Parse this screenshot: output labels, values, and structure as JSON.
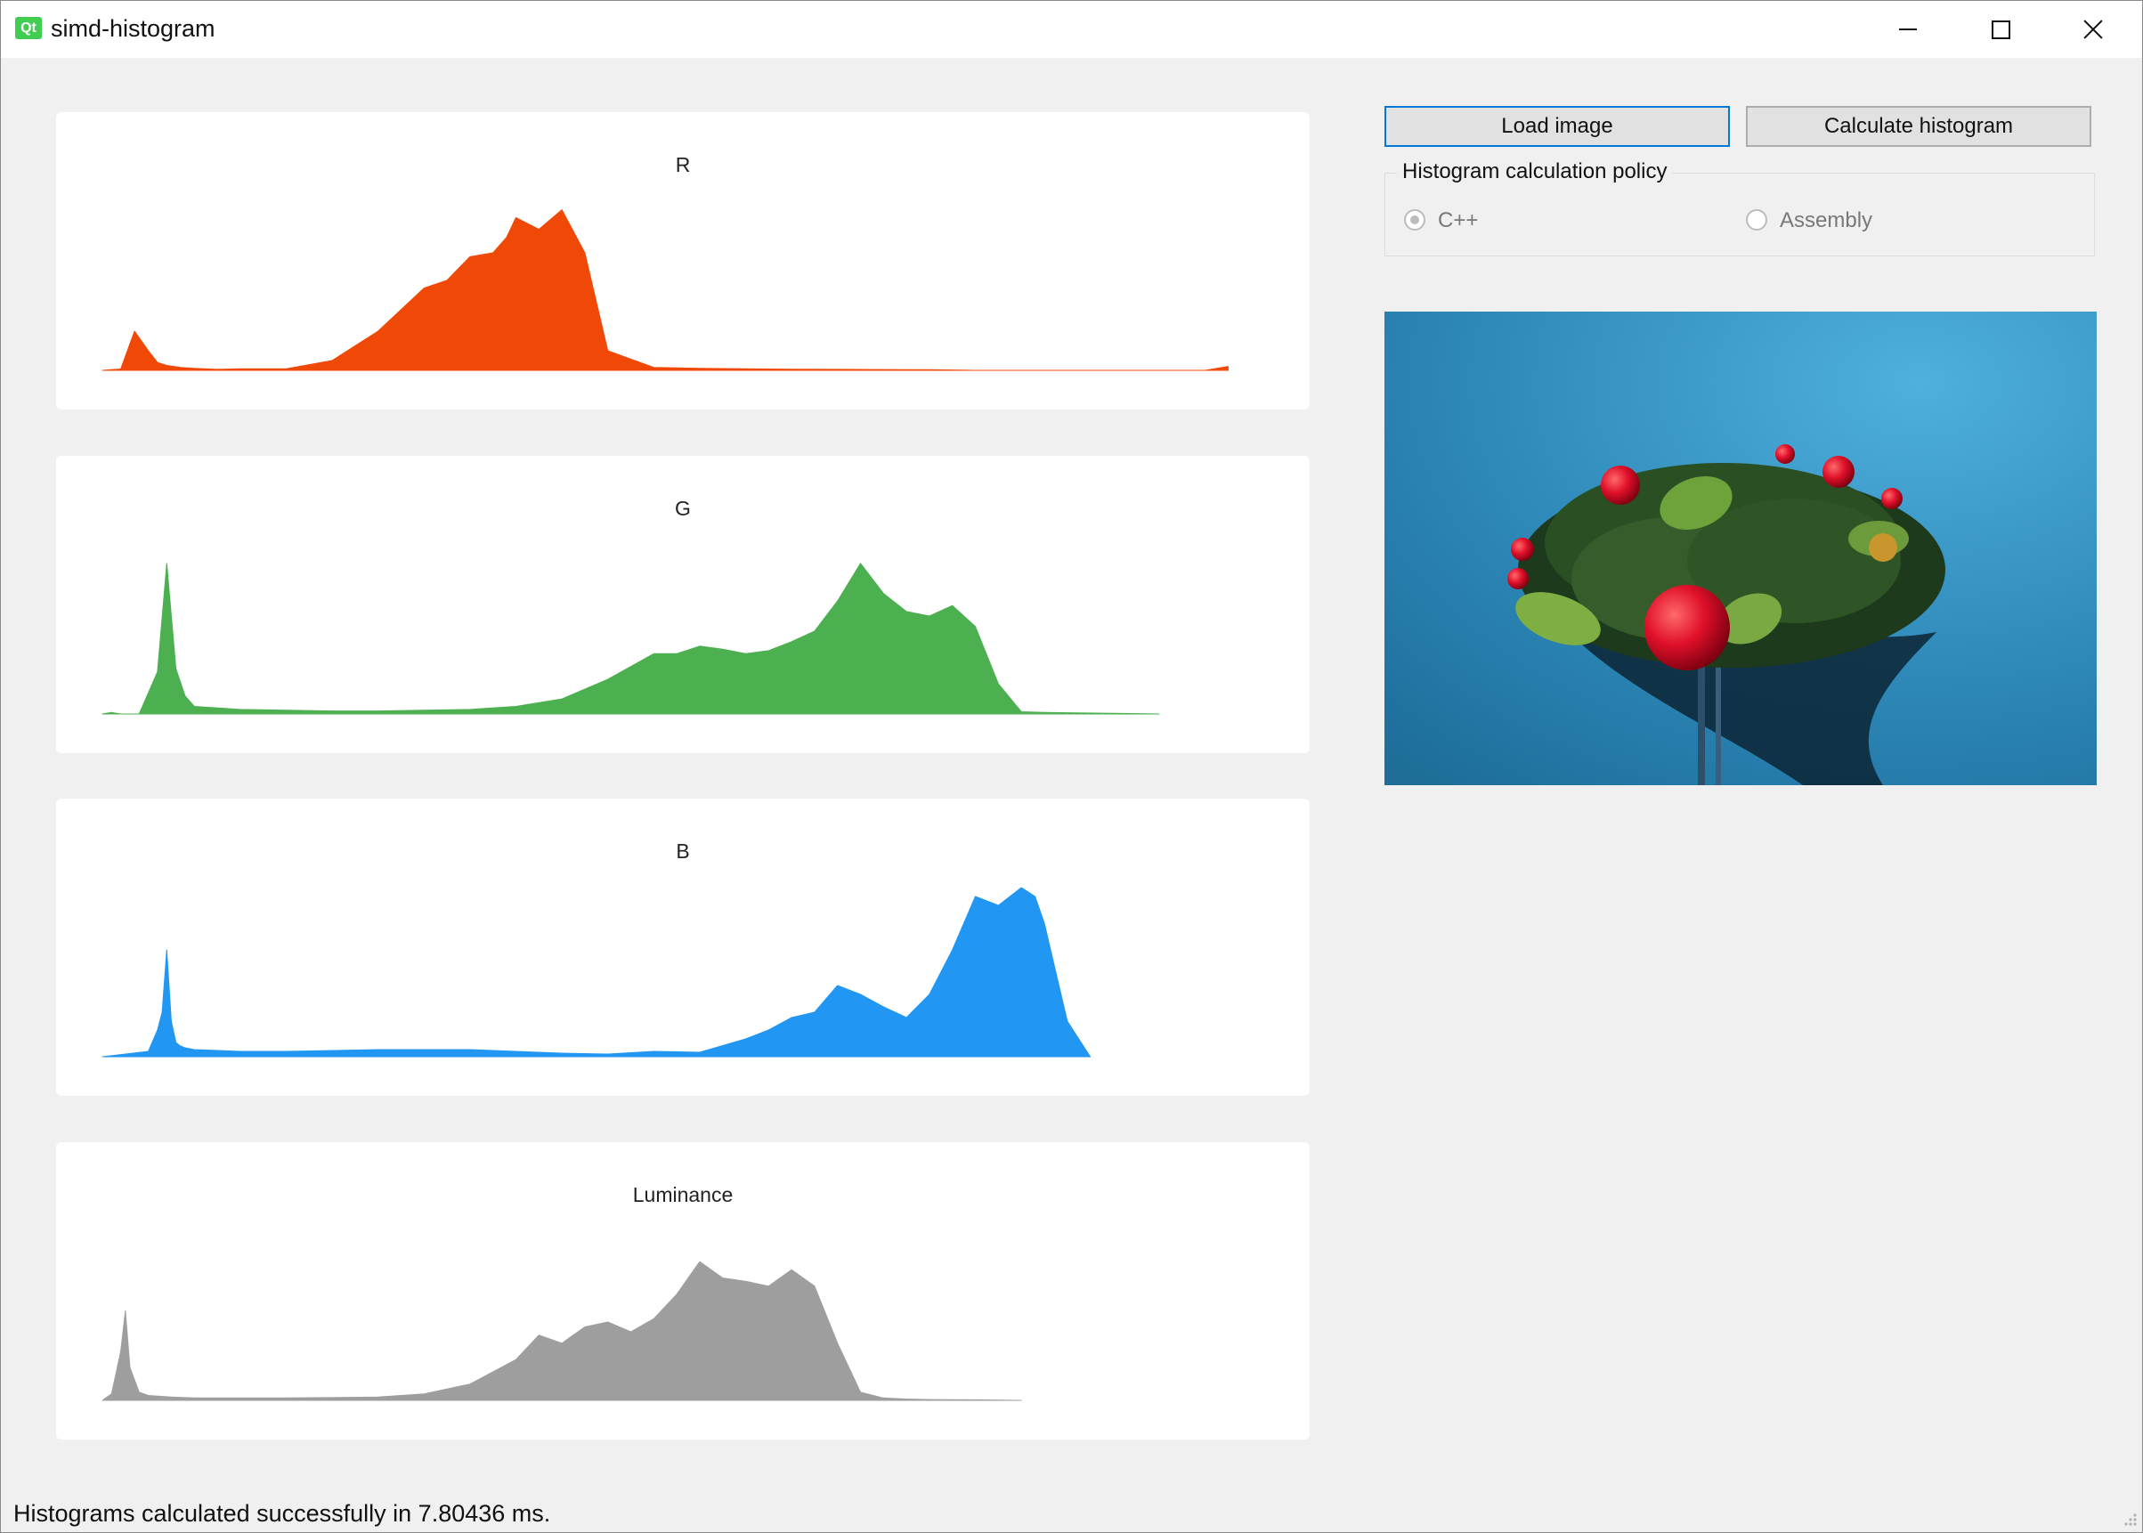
{
  "window": {
    "title": "simd-histogram",
    "logo_text": "Qt",
    "controls": [
      "minimize",
      "maximize",
      "close"
    ]
  },
  "toolbar": {
    "load_label": "Load image",
    "calculate_label": "Calculate histogram"
  },
  "policy": {
    "title": "Histogram calculation policy",
    "options": [
      {
        "label": "C++",
        "checked": true
      },
      {
        "label": "Assembly",
        "checked": false
      }
    ]
  },
  "status_text": "Histograms calculated successfully in 7.80436 ms.",
  "colors": {
    "red": "#f04907",
    "green": "#4caf50",
    "blue": "#2196f3",
    "luminance": "#9e9e9e",
    "photo_background": "#2f8cbc"
  },
  "chart_data": [
    {
      "type": "area",
      "title": "R",
      "color": "#f04907",
      "x": [
        0,
        4,
        7,
        10,
        12,
        14,
        17,
        20,
        25,
        30,
        40,
        50,
        60,
        70,
        75,
        80,
        85,
        88,
        90,
        95,
        100,
        105,
        110,
        120,
        130,
        140,
        150,
        160,
        170,
        180,
        185,
        190,
        200,
        210,
        220,
        225,
        230,
        232,
        235,
        240,
        245
      ],
      "values": [
        0,
        700,
        20000,
        10000,
        4000,
        2500,
        1500,
        1000,
        500,
        800,
        800,
        5000,
        20000,
        42000,
        46000,
        58000,
        60000,
        68000,
        78000,
        72000,
        82000,
        60000,
        10000,
        1500,
        1000,
        800,
        600,
        500,
        400,
        300,
        200,
        0,
        0,
        0,
        0,
        0,
        0,
        0,
        0,
        0,
        2000
      ],
      "ylim": [
        0,
        100000
      ],
      "xlim": [
        0,
        255
      ]
    },
    {
      "type": "area",
      "title": "G",
      "color": "#4caf50",
      "x": [
        0,
        2,
        4,
        6,
        8,
        12,
        14,
        16,
        18,
        20,
        30,
        40,
        50,
        60,
        70,
        80,
        90,
        100,
        110,
        120,
        125,
        130,
        135,
        140,
        145,
        150,
        155,
        160,
        165,
        170,
        175,
        180,
        185,
        190,
        195,
        200,
        205,
        210,
        220,
        230
      ],
      "values": [
        0,
        1000,
        0,
        0,
        0,
        28000,
        100000,
        30000,
        12000,
        5000,
        3000,
        2500,
        2000,
        2000,
        2500,
        3000,
        5000,
        10000,
        23000,
        40000,
        40000,
        45000,
        43000,
        40000,
        42000,
        48000,
        55000,
        75000,
        100000,
        80000,
        68000,
        65000,
        72000,
        58000,
        20000,
        1500,
        1000,
        800,
        500,
        0
      ],
      "ylim": [
        0,
        130000
      ],
      "xlim": [
        0,
        255
      ]
    },
    {
      "type": "area",
      "title": "B",
      "color": "#2196f3",
      "x": [
        0,
        5,
        10,
        12,
        13,
        14,
        15,
        16,
        17,
        18,
        20,
        30,
        40,
        60,
        80,
        100,
        110,
        120,
        130,
        140,
        145,
        150,
        155,
        160,
        165,
        170,
        175,
        180,
        185,
        190,
        195,
        200,
        203,
        205,
        210,
        215
      ],
      "values": [
        0,
        1500,
        3000,
        15000,
        25000,
        60000,
        20000,
        8000,
        6000,
        5000,
        4000,
        3000,
        3000,
        4000,
        4000,
        2000,
        1500,
        3000,
        2500,
        10000,
        15000,
        22000,
        25000,
        40000,
        35000,
        28000,
        22000,
        35000,
        60000,
        90000,
        85000,
        95000,
        90000,
        75000,
        20000,
        0
      ],
      "ylim": [
        0,
        110000
      ],
      "xlim": [
        0,
        255
      ]
    },
    {
      "type": "area",
      "title": "Luminance",
      "color": "#9e9e9e",
      "x": [
        0,
        2,
        4,
        5,
        6,
        8,
        10,
        15,
        20,
        40,
        60,
        70,
        80,
        90,
        95,
        100,
        105,
        110,
        115,
        120,
        125,
        130,
        135,
        140,
        145,
        150,
        155,
        160,
        165,
        170,
        175,
        180,
        190,
        200
      ],
      "values": [
        0,
        4000,
        30000,
        55000,
        20000,
        5000,
        3000,
        2000,
        1500,
        1500,
        2000,
        4000,
        10000,
        25000,
        40000,
        35000,
        45000,
        48000,
        42000,
        50000,
        65000,
        85000,
        75000,
        73000,
        70000,
        80000,
        70000,
        35000,
        5000,
        1500,
        800,
        500,
        300,
        0
      ],
      "ylim": [
        0,
        120000
      ],
      "xlim": [
        0,
        255
      ]
    }
  ]
}
